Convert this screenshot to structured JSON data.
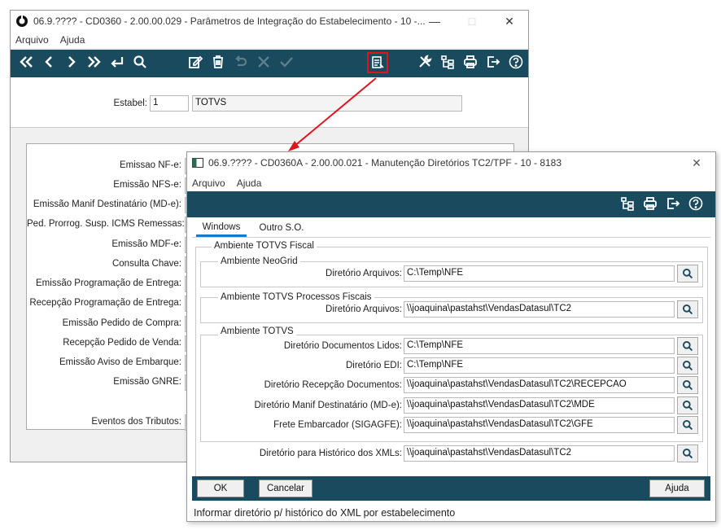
{
  "bg_window": {
    "title": "06.9.???? - CD0360 - 2.00.00.029 - Parâmetros de Integração do Estabelecimento - 10 -...",
    "menu": [
      "Arquivo",
      "Ajuda"
    ],
    "estabel_label": "Estabel:",
    "estabel_code": "1",
    "estabel_name": "TOTVS",
    "fields": [
      "Emissao NF-e:",
      "Emissão NFS-e:",
      "Emissão Manif Destinatário (MD-e):",
      "Ped. Prorrog. Susp. ICMS Remessas:",
      "Emissão MDF-e:",
      "Consulta Chave:",
      "Emissão Programação de Entrega:",
      "Recepção Programação de Entrega:",
      "Emissão Pedido de Compra:",
      "Recepção Pedido de Venda:",
      "Emissão Aviso de Embarque:",
      "Emissão GNRE:",
      "Eventos dos Tributos:"
    ]
  },
  "dialog": {
    "title": "06.9.???? - CD0360A - 2.00.00.021 - Manutenção Diretórios TC2/TPF - 10 - 8183",
    "menu": [
      "Arquivo",
      "Ajuda"
    ],
    "tabs": [
      "Windows",
      "Outro S.O."
    ],
    "main_group": "Ambiente TOTVS Fiscal",
    "neogrid": {
      "title": "Ambiente NeoGrid",
      "label": "Diretório Arquivos:",
      "value": "C:\\Temp\\NFE"
    },
    "processos": {
      "title": "Ambiente TOTVS Processos Fiscais",
      "label": "Diretório Arquivos:",
      "value": "\\\\joaquina\\pastahst\\VendasDatasul\\TC2"
    },
    "totvs": {
      "title": "Ambiente TOTVS",
      "rows": [
        {
          "label": "Diretório Documentos Lidos:",
          "value": "C:\\Temp\\NFE"
        },
        {
          "label": "Diretório EDI:",
          "value": "C:\\Temp\\NFE"
        },
        {
          "label": "Diretório Recepção Documentos:",
          "value": "\\\\joaquina\\pastahst\\VendasDatasul\\TC2\\RECEPCAO"
        },
        {
          "label": "Diretório Manif Destinatário (MD-e):",
          "value": "\\\\joaquina\\pastahst\\VendasDatasul\\TC2\\MDE"
        },
        {
          "label": "Frete Embarcador (SIGAGFE):",
          "value": "\\\\joaquina\\pastahst\\VendasDatasul\\TC2\\GFE"
        }
      ]
    },
    "historico": {
      "label": "Diretório para Histórico dos XMLs:",
      "value": "\\\\joaquina\\pastahst\\VendasDatasul\\TC2"
    },
    "buttons": {
      "ok": "OK",
      "cancel": "Cancelar",
      "help": "Ajuda"
    },
    "status": "Informar diretório p/ histórico do XML por estabelecimento"
  },
  "colors": {
    "toolbar": "#194a5e",
    "highlight": "#e0141e"
  }
}
